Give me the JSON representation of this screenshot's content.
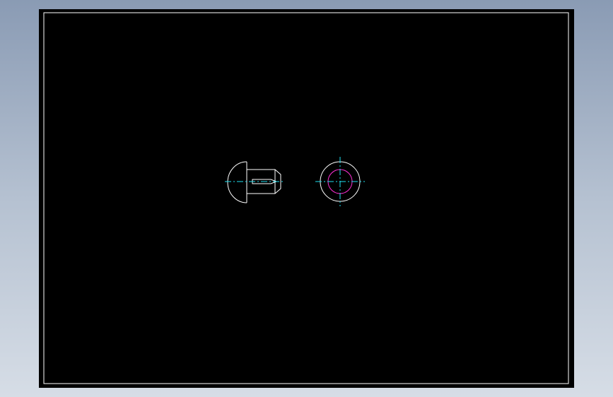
{
  "canvas": {
    "background_gradient": [
      "#8a9bb4",
      "#d6dde6"
    ],
    "sheet_color": "#000000",
    "frame_color": "#ffffff"
  },
  "views": [
    {
      "name": "side-view",
      "shape": "round-head-rivet-profile"
    },
    {
      "name": "end-view",
      "shape": "concentric-circles"
    }
  ],
  "colors": {
    "outline": "#ffffff",
    "centerline": "#1ee0f0",
    "hidden_circle": "#ff2fd6"
  }
}
